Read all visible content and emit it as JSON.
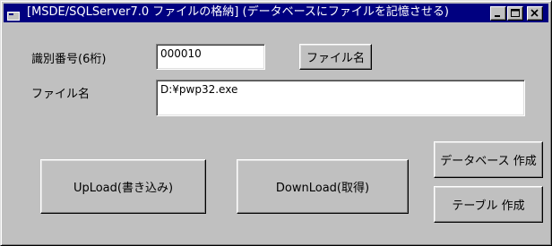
{
  "window": {
    "title": "[MSDE/SQLServer7.0 ファイルの格納] (データベースにファイルを記憶させる)",
    "icon": "app-window-icon",
    "controls": {
      "minimize": "minimize-icon",
      "maximize": "maximize-icon",
      "close": "close-icon"
    }
  },
  "form": {
    "id_label": "識別番号(6桁)",
    "id_value": "000010",
    "filename_button": "ファイル名",
    "filename_label": "ファイル名",
    "filename_value": "D:¥pwp32.exe"
  },
  "actions": {
    "upload": "UpLoad(書き込み)",
    "download": "DownLoad(取得)",
    "create_database": "データベース 作成",
    "create_table": "テーブル 作成"
  },
  "colors": {
    "titlebar": "#000080",
    "face": "#c0c0c0"
  }
}
